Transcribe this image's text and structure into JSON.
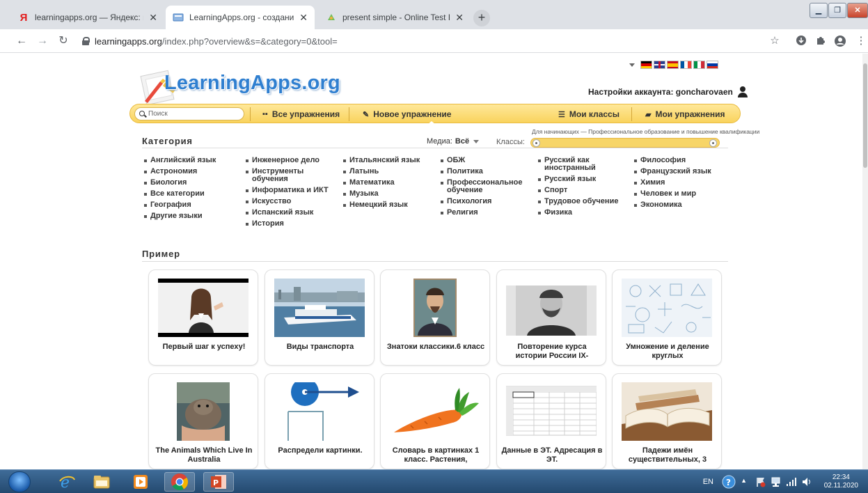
{
  "browser": {
    "tabs": [
      {
        "title": "learningapps.org — Яндекс: наш",
        "close": "✕"
      },
      {
        "title": "LearningApps.org - создание му",
        "close": "✕"
      },
      {
        "title": "present simple - Online Test Pad",
        "close": "✕"
      }
    ],
    "new_tab": "+",
    "url_domain": "learningapps.org",
    "url_path": "/index.php?overview&s=&category=0&tool="
  },
  "site": {
    "logo": "LearningApps.org",
    "account_label": "Настройки аккаунта: goncharovaen",
    "search_placeholder": "Поиск",
    "menu": {
      "all": "Все упражнения",
      "new": "Новое упражнение",
      "classes": "Мои классы",
      "mine": "Мои упражнения"
    },
    "category_heading": "Категория",
    "media_label": "Медиа:",
    "media_value": "Всё",
    "classes_label": "Классы:",
    "range_caption": "Для начинающих — Профессиональное образование и повышение квалификации",
    "categories": [
      [
        "Английский язык",
        "Астрономия",
        "Биология",
        "Все категории",
        "География",
        "Другие языки"
      ],
      [
        "Инженерное дело",
        "Инструменты обучения",
        "Информатика и ИКТ",
        "Искусство",
        "Испанский язык",
        "История"
      ],
      [
        "Итальянский язык",
        "Латынь",
        "Математика",
        "Музыка",
        "Немецкий язык"
      ],
      [
        "ОБЖ",
        "Политика",
        "Профессиональное обучение",
        "Психология",
        "Религия"
      ],
      [
        "Русский как иностранный",
        "Русский язык",
        "Спорт",
        "Трудовое обучение",
        "Физика"
      ],
      [
        "Философия",
        "Французский язык",
        "Химия",
        "Человек и мир",
        "Экономика"
      ]
    ],
    "example_heading": "Пример",
    "examples": [
      {
        "title": "Первый шаг к успеху!",
        "thumb": "girl-video"
      },
      {
        "title": "Виды транспорта",
        "thumb": "river-boat"
      },
      {
        "title": "Знатоки классики.6 класс",
        "thumb": "portrait-chekhov"
      },
      {
        "title": "Повторение курса истории России IX-",
        "thumb": "portrait-tsar"
      },
      {
        "title": "Умножение и деление круглых",
        "thumb": "math-doodles"
      },
      {
        "title": "The Animals Which Live In Australia",
        "thumb": "wombat"
      },
      {
        "title": "Распредели картинки.",
        "thumb": "pulley-arrow"
      },
      {
        "title": "Словарь в картинках 1 класс. Растения,",
        "thumb": "carrot"
      },
      {
        "title": "Данные в ЭТ. Адресация в ЭТ.",
        "thumb": "spreadsheet"
      },
      {
        "title": "Падежи имён существительных, 3",
        "thumb": "open-books"
      }
    ]
  },
  "taskbar": {
    "lang": "EN",
    "time": "22:34",
    "date": "02.11.2020"
  }
}
